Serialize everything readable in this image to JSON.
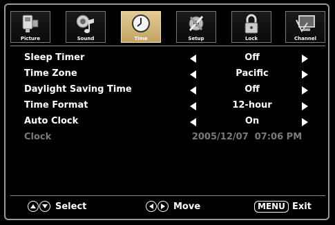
{
  "tabs": [
    {
      "label": "Picture",
      "icon": "picture-icon",
      "active": false
    },
    {
      "label": "Sound",
      "icon": "sound-icon",
      "active": false
    },
    {
      "label": "Time",
      "icon": "clock-icon",
      "active": true
    },
    {
      "label": "Setup",
      "icon": "setup-icon",
      "active": false
    },
    {
      "label": "Lock",
      "icon": "lock-icon",
      "active": false
    },
    {
      "label": "Channel",
      "icon": "channel-icon",
      "active": false
    }
  ],
  "rows": [
    {
      "label": "Sleep Timer",
      "value": "Off"
    },
    {
      "label": "Time Zone",
      "value": "Pacific"
    },
    {
      "label": "Daylight Saving Time",
      "value": "Off"
    },
    {
      "label": "Time Format",
      "value": "12-hour"
    },
    {
      "label": "Auto Clock",
      "value": "On"
    },
    {
      "label": "Clock",
      "value": "2005/12/07  07:06 PM"
    }
  ],
  "footer": {
    "select_label": "Select",
    "move_label": "Move",
    "menu_key": "MENU",
    "exit_label": "Exit"
  },
  "colors": {
    "active_tab": "#d2b67a",
    "disabled_text": "#7a7a7a"
  }
}
